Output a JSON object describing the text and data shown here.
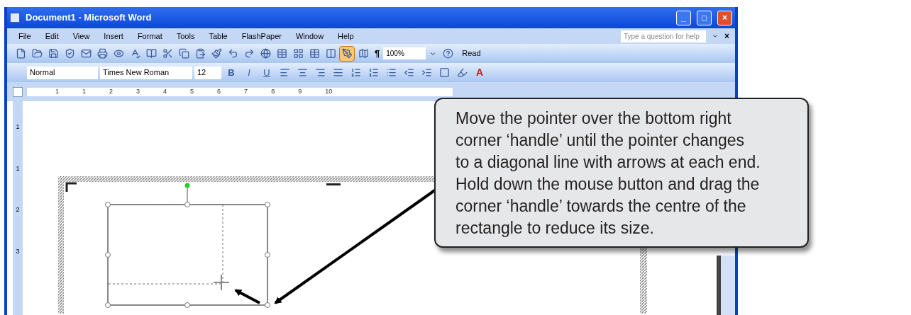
{
  "window": {
    "title": "Document1 - Microsoft Word",
    "controls": [
      "_",
      "□",
      "×"
    ]
  },
  "menu": [
    "File",
    "Edit",
    "View",
    "Insert",
    "Format",
    "Tools",
    "Table",
    "FlashPaper",
    "Window",
    "Help"
  ],
  "help_box": {
    "placeholder": "Type a question for help",
    "close": "×"
  },
  "standard_toolbar": {
    "show_formatting": "¶",
    "zoom": "100%",
    "read": "Read"
  },
  "formatting_toolbar": {
    "style": "Normal",
    "font": "Times New Roman",
    "size": "12",
    "bold": "B",
    "italic": "I",
    "underline": "U",
    "font_color": "A"
  },
  "ruler": {
    "numbers": [
      "1",
      "1",
      "2",
      "3",
      "4",
      "5",
      "6",
      "7",
      "8",
      "9",
      "10"
    ]
  },
  "vertical_ruler": {
    "numbers": [
      "1",
      "1",
      "2",
      "3"
    ]
  },
  "callout": {
    "lines": [
      "Move the pointer over the bottom right",
      "corner ‘handle’ until the pointer changes",
      "to a diagonal line with arrows at each end.",
      "Hold down the mouse button and drag the",
      "corner ‘handle’ towards the centre of the",
      "rectangle to reduce its size."
    ]
  }
}
